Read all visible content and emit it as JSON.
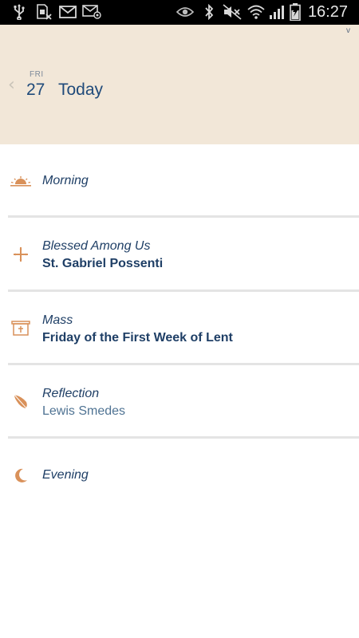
{
  "status_bar": {
    "time": "16:27",
    "icons": [
      "usb-icon",
      "sim-blocked-icon",
      "gmail-icon",
      "email-icon",
      "eye-icon",
      "bluetooth-icon",
      "mute-icon",
      "wifi-icon",
      "signal-icon",
      "battery-icon"
    ]
  },
  "header": {
    "version_label": "v",
    "day_of_week": "FRI",
    "day_number": "27",
    "today_label": "Today"
  },
  "items": [
    {
      "title": "Morning",
      "subtitle": "",
      "icon": "sunrise-icon"
    },
    {
      "title": "Blessed Among Us",
      "subtitle": "St. Gabriel Possenti",
      "icon": "cross-icon"
    },
    {
      "title": "Mass",
      "subtitle": "Friday of the First Week of Lent",
      "icon": "altar-icon"
    },
    {
      "title": "Reflection",
      "subtitle": "Lewis Smedes",
      "icon": "feather-icon"
    },
    {
      "title": "Evening",
      "subtitle": "",
      "icon": "moon-icon"
    }
  ],
  "colors": {
    "header_bg": "#f2e7d8",
    "accent_icon": "#d9915a",
    "text_primary": "#1f3f66",
    "text_secondary": "#4f7393"
  }
}
